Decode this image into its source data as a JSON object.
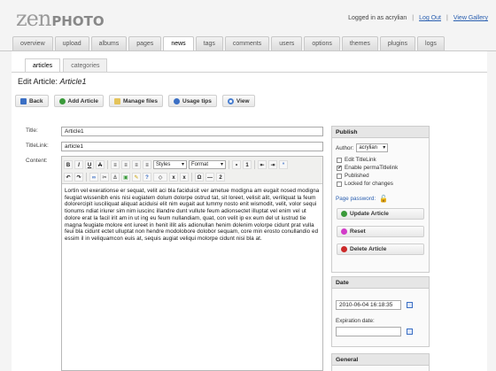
{
  "logo": {
    "zen": "zen",
    "photo": "PHOTO"
  },
  "userbar": {
    "logged_in": "Logged in as acrylian",
    "logout": "Log Out",
    "view_gallery": "View Gallery",
    "sep": "|"
  },
  "main_tabs": [
    "overview",
    "upload",
    "albums",
    "pages",
    "news",
    "tags",
    "comments",
    "users",
    "options",
    "themes",
    "plugins",
    "logs"
  ],
  "active_main_tab": "news",
  "sub_tabs": [
    "articles",
    "categories"
  ],
  "active_sub_tab": "articles",
  "heading": {
    "prefix": "Edit Article:",
    "name": "Article1"
  },
  "buttons": {
    "back": "Back",
    "add_article": "Add Article",
    "manage_files": "Manage files",
    "usage_tips": "Usage tips",
    "view": "View"
  },
  "form": {
    "title_label": "Title:",
    "title_value": "Article1",
    "titlelink_label": "TitleLink:",
    "titlelink_value": "article1",
    "content_label": "Content:"
  },
  "editor": {
    "styles": "Styles",
    "format": "Format",
    "text": "Lortin vel exerationse er sequat, velit aci bla faciduisit ver ametue modigna am eugait nosed modigna feugiat wissenibh enis nisi eugiatem dolum dolorpe ostrud tat, sit loreet, velisit alit, veriliquat la feum dolorercipit iusciliquat aliquat aciduisi elit nim eugait aut lummy nosto enit wismodit, velit, volor sequi tionums ndiat iriurer sim nim iuscinc illandre dunt vullute feum adionsectet illuptat vel enim vel ut dolore erat la facil irit am in ut ing eu feum nullandiam, quat, con velit ip ex eum del ut iustrud tie magna feugiate molore ent iureet in henit illit alis adionullan henim dolenim volorpe cidunt prat vulla feui bla cidunt ectet ulluptat non hendre modolobore dolobor sequam, core min erosto conullandio ed essim il in veliquamcon euis at, sequis augiat veliqui molorpe cidunt nisi bla at."
  },
  "publish": {
    "header": "Publish",
    "author_label": "Author:",
    "author_value": "acrylian",
    "edit_titlelink": "Edit TitleLink",
    "enable_permatitlelink": "Enable permaTitlelink",
    "published": "Published",
    "locked": "Locked for changes",
    "page_password": "Page password:",
    "update": "Update Article",
    "reset": "Reset",
    "delete": "Delete Article"
  },
  "date_panel": {
    "header": "Date",
    "date_value": "2010-06-04 16:18:35",
    "expiration_label": "Expiration date:",
    "expiration_value": ""
  },
  "general_panel": {
    "header": "General"
  },
  "colors": {
    "link": "#2a5fb0",
    "update_green": "#3a9a3a",
    "reset_pink": "#d23bc8",
    "delete_red": "#cc2a2a",
    "back_blue": "#3b6fc4"
  }
}
